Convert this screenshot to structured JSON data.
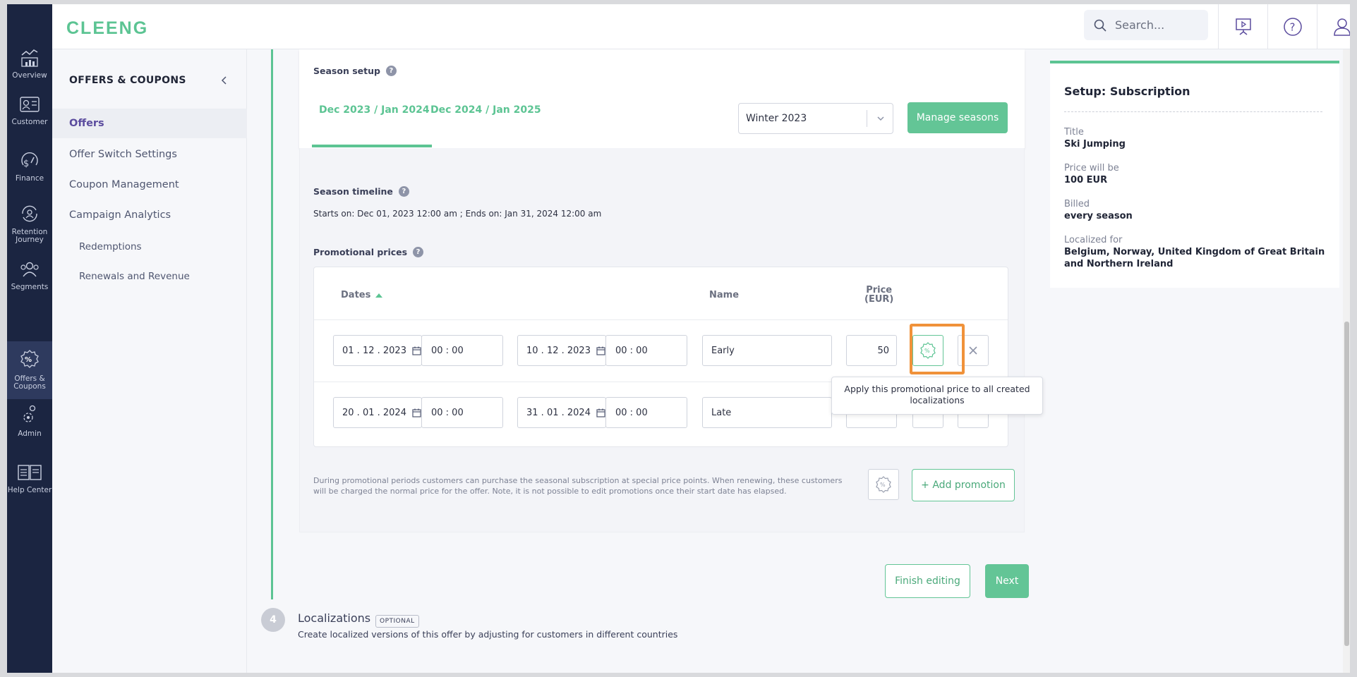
{
  "app": {
    "logo": "CLEENG"
  },
  "topbar": {
    "search_placeholder": "Search..."
  },
  "rail": [
    {
      "label": "Overview",
      "icon": "chart-icon"
    },
    {
      "label": "Customer",
      "icon": "customer-icon"
    },
    {
      "label": "Finance",
      "icon": "finance-icon"
    },
    {
      "label": "Retention Journey",
      "icon": "retention-icon"
    },
    {
      "label": "Segments",
      "icon": "segments-icon"
    },
    {
      "label": "Offers & Coupons",
      "icon": "percent-icon"
    },
    {
      "label": "Admin",
      "icon": "admin-icon"
    },
    {
      "label": "Help Center",
      "icon": "help-center-icon"
    }
  ],
  "subnav": {
    "title": "OFFERS & COUPONS",
    "items": [
      "Offers",
      "Offer Switch Settings",
      "Coupon Management",
      "Campaign Analytics"
    ],
    "subitems": [
      "Redemptions",
      "Renewals and Revenue"
    ]
  },
  "season_setup": {
    "label": "Season setup",
    "tabs": [
      "Dec 2023 / Jan 2024",
      "Dec 2024 / Jan 2025"
    ],
    "selected_season": "Winter 2023",
    "manage_button": "Manage seasons"
  },
  "season_timeline": {
    "label": "Season timeline",
    "text": "Starts on: Dec 01, 2023 12:00 am ; Ends on: Jan 31, 2024 12:00 am"
  },
  "promotional_prices": {
    "label": "Promotional prices",
    "columns": {
      "dates": "Dates",
      "name": "Name",
      "price_line1": "Price",
      "price_line2": "(EUR)"
    },
    "rows": [
      {
        "start_date": "01 . 12 . 2023",
        "start_time": "00 : 00",
        "end_date": "10 . 12 . 2023",
        "end_time": "00 : 00",
        "name": "Early",
        "price": "50"
      },
      {
        "start_date": "20 . 01 . 2024",
        "start_time": "00 : 00",
        "end_date": "31 . 01 . 2024",
        "end_time": "00 : 00",
        "name": "Late",
        "price": ""
      }
    ],
    "tooltip": "Apply this promotional price to all created localizations",
    "footnote": "During promotional periods customers can purchase the seasonal subscription at special price points. When renewing, these customers will be charged the normal price for the offer. Note, it is not possible to edit promotions once their start date has elapsed.",
    "add_button": "+ Add promotion"
  },
  "actions": {
    "finish": "Finish editing",
    "next": "Next"
  },
  "localizations": {
    "step": "4",
    "title": "Localizations",
    "badge": "OPTIONAL",
    "description": "Create localized versions of this offer by adjusting for customers in different countries"
  },
  "summary": {
    "title": "Setup: Subscription",
    "fields": [
      {
        "label": "Title",
        "value": "Ski Jumping"
      },
      {
        "label": "Price will be",
        "value": "100 EUR"
      },
      {
        "label": "Billed",
        "value": "every season"
      },
      {
        "label": "Localized for",
        "value": "Belgium, Norway, United Kingdom of Great Britain and Northern Ireland"
      }
    ]
  },
  "colors": {
    "accent": "#5cc493",
    "rail": "#1b2541",
    "highlight": "#f0923a"
  }
}
